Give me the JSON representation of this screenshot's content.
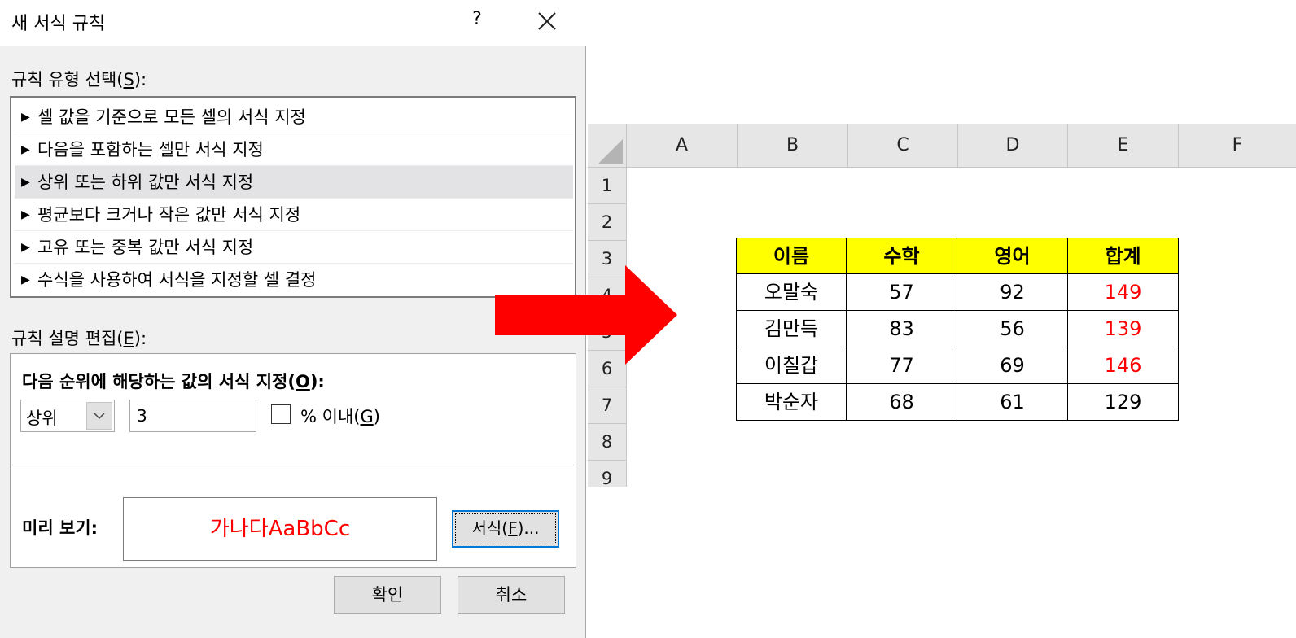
{
  "dialog": {
    "title": "새 서식 규칙",
    "help": "?",
    "rule_type_label": "규칙 유형 선택(",
    "rule_type_key": "S",
    "rule_type_suffix": "):",
    "rule_types": [
      "셀 값을 기준으로 모든 셀의 서식 지정",
      "다음을 포함하는 셀만 서식 지정",
      "상위 또는 하위 값만 서식 지정",
      "평균보다 크거나 작은 값만 서식 지정",
      "고유 또는 중복 값만 서식 지정",
      "수식을 사용하여 서식을 지정할 셀 결정"
    ],
    "selected_rule_index": 2,
    "edit_label": "규칙 설명 편집(",
    "edit_key": "E",
    "edit_suffix": "):",
    "desc_title": "다음 순위에 해당하는 값의 서식 지정(",
    "desc_key": "O",
    "desc_suffix": "):",
    "rank_select": "상위",
    "rank_value": "3",
    "percent_checked": false,
    "percent_label": "% 이내(",
    "percent_key": "G",
    "percent_suffix": ")",
    "preview_label": "미리 보기:",
    "preview_text": "가나다AaBbCc",
    "format_label": "서식(",
    "format_key": "F",
    "format_suffix": ")...",
    "ok": "확인",
    "cancel": "취소"
  },
  "sheet": {
    "columns": [
      "A",
      "B",
      "C",
      "D",
      "E",
      "F"
    ],
    "rows": [
      "1",
      "2",
      "3",
      "4",
      "5",
      "6",
      "7",
      "8",
      "9"
    ],
    "table_header": [
      "이름",
      "수학",
      "영어",
      "합계"
    ],
    "table_rows": [
      [
        "오말숙",
        "57",
        "92",
        "149"
      ],
      [
        "김만득",
        "83",
        "56",
        "139"
      ],
      [
        "이칠갑",
        "77",
        "69",
        "146"
      ],
      [
        "박순자",
        "68",
        "61",
        "129"
      ]
    ],
    "highlight_rows": [
      0,
      1,
      2
    ],
    "highlight_color": "#ff0000",
    "header_fill": "#ffff00"
  },
  "arrow_color": "#ff0000"
}
